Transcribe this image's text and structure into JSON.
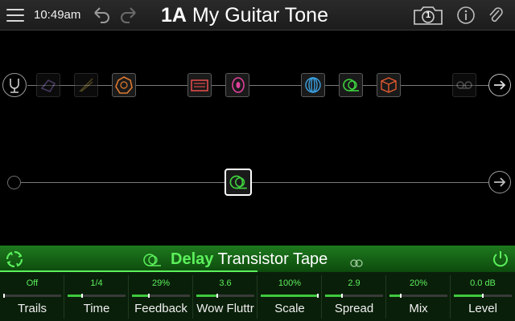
{
  "topbar": {
    "time": "10:49am",
    "preset_number": "1A",
    "preset_name": "My Guitar Tone",
    "snapshot_number": "1"
  },
  "colors": {
    "accent_green": "#5cf05c",
    "header_green": "#1e7a1e",
    "compressor": "#9b7fd0",
    "drive": "#b7a24a",
    "mod": "#e07a30",
    "amp": "#e04a4a",
    "cab": "#e0409a",
    "reverb": "#3aa0e0",
    "delay": "#3ed03e",
    "fx": "#e05a30",
    "looper": "#888888"
  },
  "path1": {
    "blocks": [
      {
        "name": "compressor-block",
        "icon": "compressor-icon"
      },
      {
        "name": "drive-block",
        "icon": "drive-icon"
      },
      {
        "name": "modulation-block",
        "icon": "modulation-icon"
      },
      {
        "name": "amp-block",
        "icon": "amp-icon"
      },
      {
        "name": "cab-block",
        "icon": "cab-icon"
      },
      {
        "name": "reverb-block",
        "icon": "reverb-icon"
      },
      {
        "name": "delay-block",
        "icon": "delay-icon"
      },
      {
        "name": "fx-block",
        "icon": "cube-icon"
      },
      {
        "name": "looper-block",
        "icon": "looper-icon"
      }
    ]
  },
  "path2": {
    "blocks": [
      {
        "name": "delay-block-selected",
        "icon": "delay-icon"
      }
    ]
  },
  "edit": {
    "category": "Delay",
    "model": "Transistor Tape",
    "params": [
      {
        "label": "Trails",
        "value": "Off",
        "level": 0.0
      },
      {
        "label": "Time",
        "value": "1/4",
        "level": 0.25
      },
      {
        "label": "Feedback",
        "value": "29%",
        "level": 0.29
      },
      {
        "label": "Wow Fluttr",
        "value": "3.6",
        "level": 0.36
      },
      {
        "label": "Scale",
        "value": "100%",
        "level": 1.0
      },
      {
        "label": "Spread",
        "value": "2.9",
        "level": 0.29
      },
      {
        "label": "Mix",
        "value": "20%",
        "level": 0.2
      },
      {
        "label": "Level",
        "value": "0.0 dB",
        "level": 0.5
      }
    ]
  }
}
